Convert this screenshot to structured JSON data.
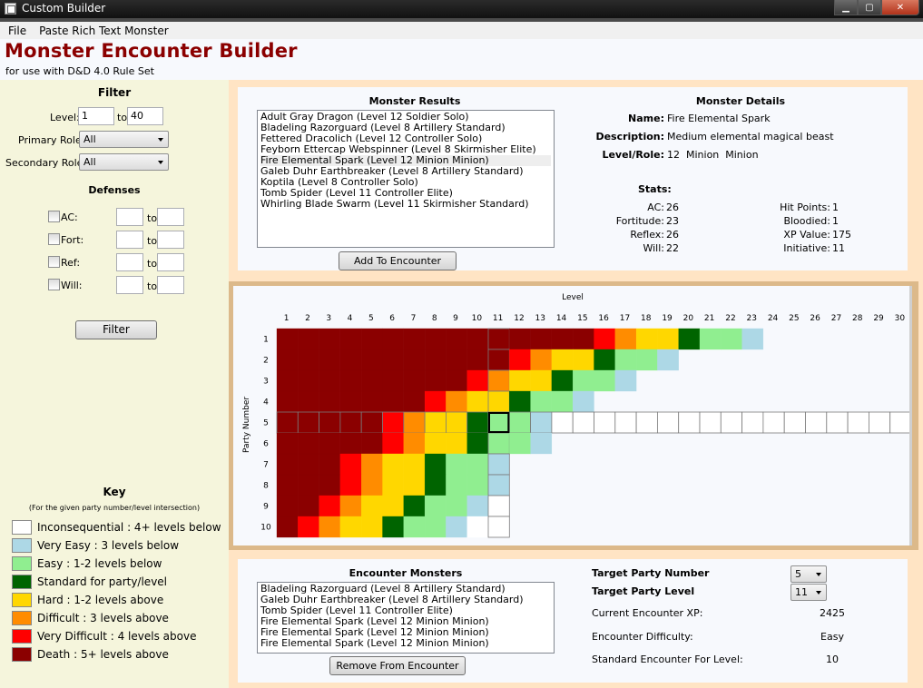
{
  "window": {
    "title": "Custom Builder",
    "minimize_glyph": "▁",
    "maximize_glyph": "▢",
    "close_glyph": "✕"
  },
  "menu": [
    "File",
    "Paste Rich Text Monster"
  ],
  "header": {
    "title": "Monster Encounter Builder",
    "subtitle": "for use with D&D 4.0 Rule Set"
  },
  "filter": {
    "heading": "Filter",
    "level_label": "Level:",
    "level_from": "1",
    "to_label": "to",
    "level_to": "40",
    "primary_role_label": "Primary Role:",
    "primary_role": "All",
    "secondary_role_label": "Secondary Role:",
    "secondary_role": "All",
    "defenses_heading": "Defenses",
    "defenses": [
      {
        "label": "AC:",
        "from": "",
        "to": ""
      },
      {
        "label": "Fort:",
        "from": "",
        "to": ""
      },
      {
        "label": "Ref:",
        "from": "",
        "to": ""
      },
      {
        "label": "Will:",
        "from": "",
        "to": ""
      }
    ],
    "button": "Filter"
  },
  "key": {
    "heading": "Key",
    "note": "(For the given party number/level intersection)",
    "items": [
      {
        "label": "Inconsequential : 4+ levels below",
        "color": "#ffffff"
      },
      {
        "label": "Very Easy : 3 levels below",
        "color": "#add8e6"
      },
      {
        "label": "Easy : 1-2 levels below",
        "color": "#90ee90"
      },
      {
        "label": "Standard for party/level",
        "color": "#006400"
      },
      {
        "label": "Hard : 1-2 levels above",
        "color": "#ffd700"
      },
      {
        "label": "Difficult : 3 levels above",
        "color": "#ff8c00"
      },
      {
        "label": "Very Difficult : 4 levels above",
        "color": "#ff0000"
      },
      {
        "label": "Death : 5+ levels above",
        "color": "#8b0000"
      }
    ]
  },
  "results": {
    "heading": "Monster Results",
    "items": [
      "Adult Gray Dragon (Level 12 Soldier Solo)",
      "Bladeling Razorguard (Level 8 Artillery Standard)",
      "Fettered Dracolich (Level 12 Controller Solo)",
      "Feyborn Ettercap Webspinner (Level 8 Skirmisher Elite)",
      "Fire Elemental Spark (Level 12 Minion Minion)",
      "Galeb Duhr Earthbreaker (Level 8 Artillery Standard)",
      "Koptila (Level 8 Controller Solo)",
      "Tomb Spider (Level 11 Controller Elite)",
      "Whirling Blade Swarm (Level 11 Skirmisher Standard)"
    ],
    "selected_index": 4,
    "button": "Add To Encounter"
  },
  "details": {
    "heading": "Monster Details",
    "name_label": "Name:",
    "name": "Fire Elemental Spark",
    "desc_label": "Description:",
    "desc": "Medium elemental magical beast",
    "level_label": "Level/Role:",
    "level": "12  Minion  Minion",
    "stats_heading": "Stats:",
    "stats_left": [
      {
        "label": "AC:",
        "value": "26"
      },
      {
        "label": "Fortitude:",
        "value": "23"
      },
      {
        "label": "Reflex:",
        "value": "26"
      },
      {
        "label": "Will:",
        "value": "22"
      }
    ],
    "stats_right": [
      {
        "label": "Hit Points:",
        "value": "1"
      },
      {
        "label": "Bloodied:",
        "value": "1"
      },
      {
        "label": "XP Value:",
        "value": "175"
      },
      {
        "label": "Initiative:",
        "value": "11"
      }
    ]
  },
  "grid": {
    "x_title": "Level",
    "y_title": "Party Number",
    "levels": [
      1,
      2,
      3,
      4,
      5,
      6,
      7,
      8,
      9,
      10,
      11,
      12,
      13,
      14,
      15,
      16,
      17,
      18,
      19,
      20,
      21,
      22,
      23,
      24,
      25,
      26,
      27,
      28,
      29,
      30
    ],
    "party_numbers": [
      1,
      2,
      3,
      4,
      5,
      6,
      7,
      8,
      9,
      10
    ],
    "highlight_row": 5,
    "highlight_col": 11,
    "colors": {
      "I": "#ffffff",
      "V": "#add8e6",
      "E": "#90ee90",
      "S": "#006400",
      "H": "#ffd700",
      "D": "#ff8c00",
      "X": "#ff0000",
      "K": "#8b0000"
    },
    "rows": [
      "KKKKKKKKKKKKKKKXDHHSEEV",
      "KKKKKKKKKKKXDHHSEEV",
      "KKKKKKKKKXDHHSEEV",
      "KKKKKKKXDHHSEEV",
      "KKKKKXDHHSEEVIIIIIIIIIIIIIIIII",
      "KKKKKXDHHSEEV",
      "KKKXDHHSEEV",
      "KKKXDHHSEEV",
      "KKXDHHSEEVI",
      "KXDHHSEEVII"
    ]
  },
  "encounter": {
    "heading": "Encounter Monsters",
    "items": [
      "Bladeling Razorguard (Level 8 Artillery Standard)",
      "Galeb Duhr Earthbreaker (Level 8 Artillery Standard)",
      "Tomb Spider (Level 11 Controller Elite)",
      "Fire Elemental Spark (Level 12 Minion Minion)",
      "Fire Elemental Spark (Level 12 Minion Minion)",
      "Fire Elemental Spark (Level 12 Minion Minion)"
    ],
    "button": "Remove From Encounter",
    "target_party_number_label": "Target Party Number",
    "target_party_number": "5",
    "target_party_level_label": "Target Party Level",
    "target_party_level": "11",
    "current_xp_label": "Current Encounter XP:",
    "current_xp": "2425",
    "difficulty_label": "Encounter Difficulty:",
    "difficulty": "Easy",
    "standard_label": "Standard Encounter For Level:",
    "standard": "10"
  }
}
